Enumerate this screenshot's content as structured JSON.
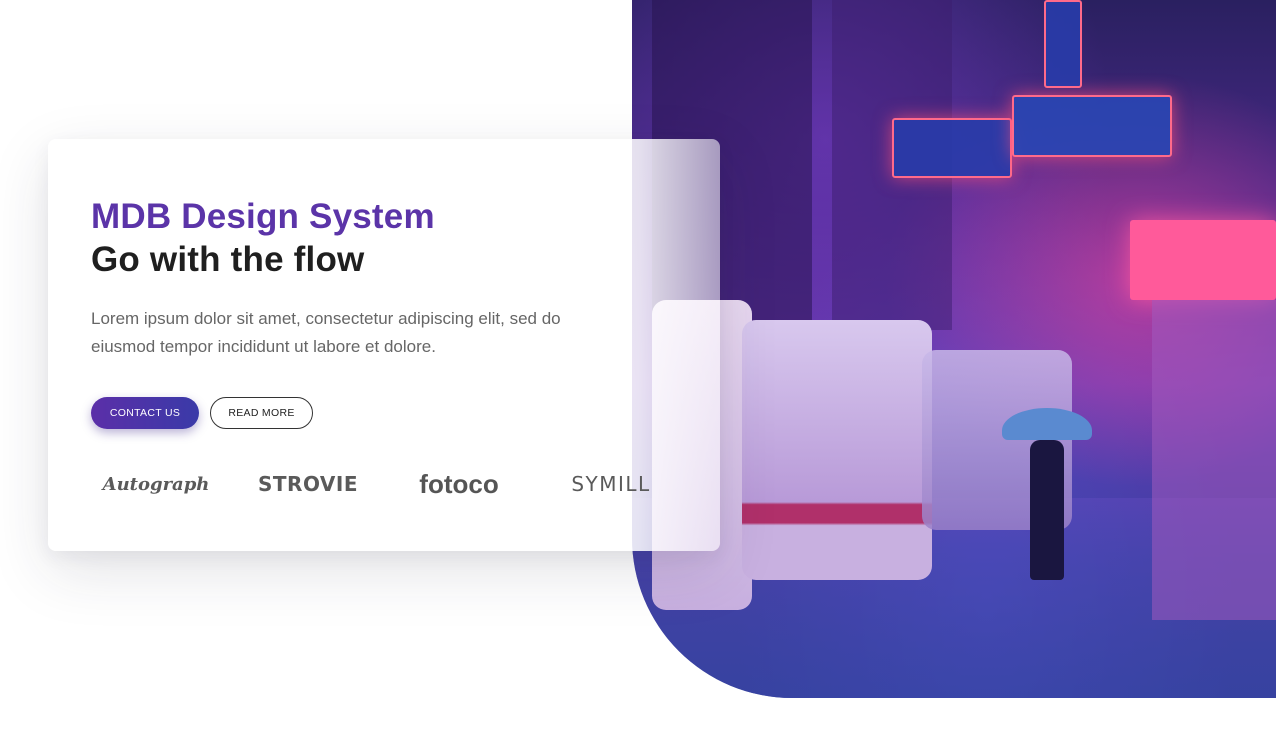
{
  "hero": {
    "title_line1": "MDB Design System",
    "title_line2": "Go with the flow",
    "lead": "Lorem ipsum dolor sit amet, consectetur adipiscing elit, sed do eiusmod tempor incididunt ut labore et dolore.",
    "buttons": {
      "contact_label": "CONTACT US",
      "read_more_label": "READ MORE"
    },
    "logos": [
      "Autograph",
      "STROVIE",
      "fotoco",
      "SYMILL"
    ]
  },
  "colors": {
    "title_accent": "#5b34a8",
    "primary_button_start": "#5b2fa8",
    "primary_button_end": "#3a3aa8"
  },
  "image": {
    "subject": "neon-lit rainy city street with minibuses"
  }
}
